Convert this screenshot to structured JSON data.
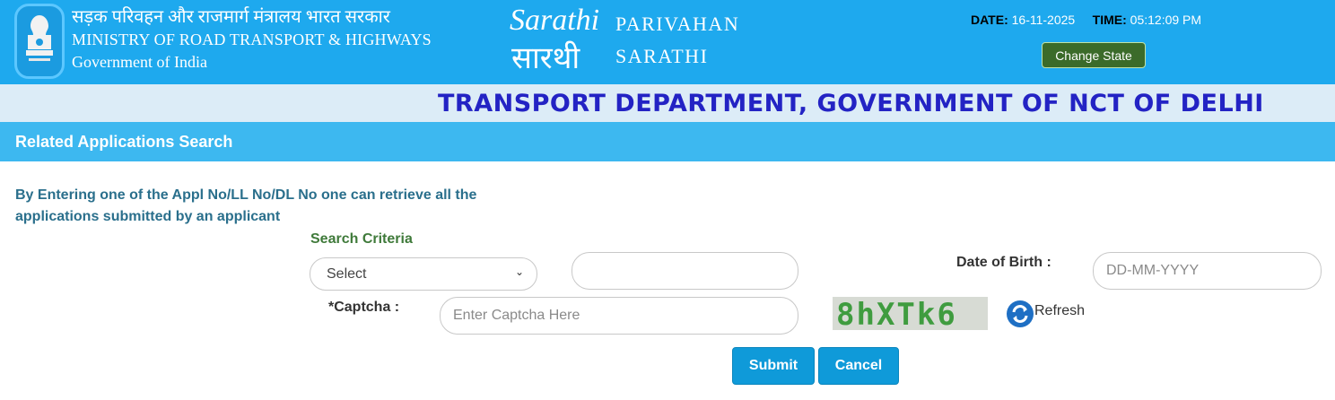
{
  "header": {
    "ministry_hindi": "सड़क परिवहन और राजमार्ग मंत्रालय भारत सरकार",
    "ministry_english": "MINISTRY OF ROAD TRANSPORT & HIGHWAYS",
    "government": "Government of India",
    "logo_english": "Sarathi",
    "logo_hindi": "सारथी",
    "brand_line1": "PARIVAHAN",
    "brand_line2": "SARATHI",
    "date_label": "DATE:",
    "date_value": "16-11-2025",
    "time_label": "TIME:",
    "time_value": "05:12:09 PM",
    "change_state_label": "Change State"
  },
  "department": "TRANSPORT DEPARTMENT, GOVERNMENT OF NCT OF DELHI",
  "section_title": "Related Applications Search",
  "info_text": "By Entering one of the Appl No/LL No/DL No one can retrieve all the applications submitted by an applicant",
  "form": {
    "search_criteria_label": "Search Criteria",
    "select_value": "Select",
    "dob_label": "Date of Birth :",
    "dob_placeholder": "DD-MM-YYYY",
    "captcha_label": "*Captcha :",
    "captcha_placeholder": "Enter Captcha Here",
    "captcha_text": "8hXTk6",
    "refresh_label": "Refresh",
    "submit_label": "Submit",
    "cancel_label": "Cancel"
  },
  "colors": {
    "header_blue": "#1ea9ee",
    "section_blue": "#3db8f0",
    "dept_text": "#2323c4",
    "change_state_green": "#3b6b2a",
    "button_blue": "#0f9ad9"
  }
}
